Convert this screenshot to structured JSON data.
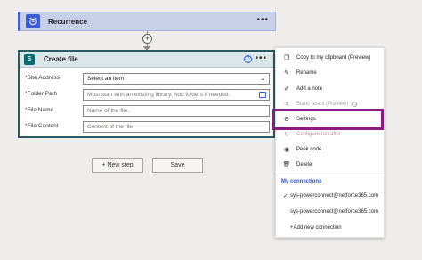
{
  "recurrence": {
    "title": "Recurrence",
    "menu_icon": "ellipsis-icon"
  },
  "connector": {
    "icon": "plus-icon",
    "symbol": "+"
  },
  "create_file": {
    "title": "Create file",
    "fields": [
      {
        "label": "Site Address",
        "required": true,
        "value": "Select an item",
        "kind": "dropdown"
      },
      {
        "label": "Folder Path",
        "required": true,
        "placeholder": "Must start with an existing library. Add folders if needed.",
        "kind": "folder"
      },
      {
        "label": "File Name",
        "required": true,
        "placeholder": "Name of the file.",
        "kind": "text"
      },
      {
        "label": "File Content",
        "required": true,
        "placeholder": "Content of the file",
        "kind": "text"
      }
    ]
  },
  "actions": {
    "new_step": "+ New step",
    "save": "Save"
  },
  "menu": {
    "items": [
      {
        "label": "Copy to my clipboard (Preview)",
        "icon": "copy-icon",
        "disabled": false
      },
      {
        "label": "Rename",
        "icon": "rename-icon",
        "disabled": false
      },
      {
        "label": "Add a note",
        "icon": "note-icon",
        "disabled": false
      },
      {
        "label": "Static result (Preview)",
        "icon": "flask-icon",
        "disabled": true
      },
      {
        "label": "Settings",
        "icon": "gear-icon",
        "disabled": false
      },
      {
        "label": "Configure run after",
        "icon": "run-after-icon",
        "disabled": true
      },
      {
        "label": "Peek code",
        "icon": "eye-icon",
        "disabled": false
      },
      {
        "label": "Delete",
        "icon": "trash-icon",
        "disabled": false
      }
    ],
    "connections_title": "My connections",
    "connections": [
      {
        "label": "sys-powerconnect@netforce365.com",
        "selected": true
      },
      {
        "label": "sys-powerconnect@netforce365.com",
        "selected": false
      }
    ],
    "add_connection": "+Add new connection"
  },
  "colors": {
    "accent": "#2b4fd8",
    "highlight": "#8a1b80",
    "card_border": "#2c5a62"
  }
}
